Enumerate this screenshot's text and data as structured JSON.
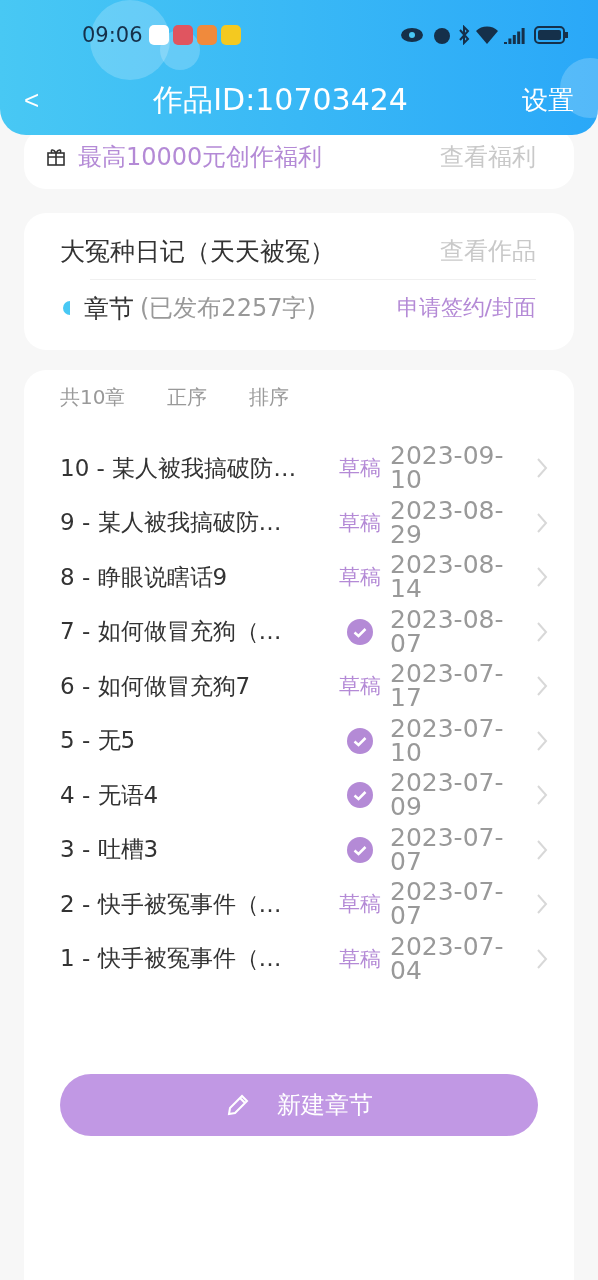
{
  "status_bar": {
    "time": "09:06"
  },
  "header": {
    "back": "<",
    "title": "作品ID:10703424",
    "action": "设置"
  },
  "promo": {
    "text": "最高10000元创作福利",
    "link": "查看福利"
  },
  "work": {
    "title": "大冤种日记（天天被冤）",
    "link": "查看作品",
    "section": "章节",
    "published": "(已发布2257字)",
    "action": "申请签约/封面"
  },
  "chapters": {
    "count": "共10章",
    "order": "正序",
    "sort": "排序",
    "items": [
      {
        "title": "10 - 某人被我搞破防…",
        "status": {
          "kind": "draft",
          "label": "草稿"
        },
        "date": "2023-09-10"
      },
      {
        "title": "9 - 某人被我搞破防…",
        "status": {
          "kind": "draft",
          "label": "草稿"
        },
        "date": "2023-08-29"
      },
      {
        "title": "8 - 睁眼说瞎话9",
        "status": {
          "kind": "draft",
          "label": "草稿"
        },
        "date": "2023-08-14"
      },
      {
        "title": "7 - 如何做冒充狗（…",
        "status": {
          "kind": "published"
        },
        "date": "2023-08-07"
      },
      {
        "title": "6 - 如何做冒充狗7",
        "status": {
          "kind": "draft",
          "label": "草稿"
        },
        "date": "2023-07-17"
      },
      {
        "title": "5 - 无5",
        "status": {
          "kind": "published"
        },
        "date": "2023-07-10"
      },
      {
        "title": "4 - 无语4",
        "status": {
          "kind": "published"
        },
        "date": "2023-07-09"
      },
      {
        "title": "3 - 吐槽3",
        "status": {
          "kind": "published"
        },
        "date": "2023-07-07"
      },
      {
        "title": "2 - 快手被冤事件（…",
        "status": {
          "kind": "draft",
          "label": "草稿"
        },
        "date": "2023-07-07"
      },
      {
        "title": "1 - 快手被冤事件（…",
        "status": {
          "kind": "draft",
          "label": "草稿"
        },
        "date": "2023-07-04"
      }
    ]
  },
  "new_button": "新建章节"
}
